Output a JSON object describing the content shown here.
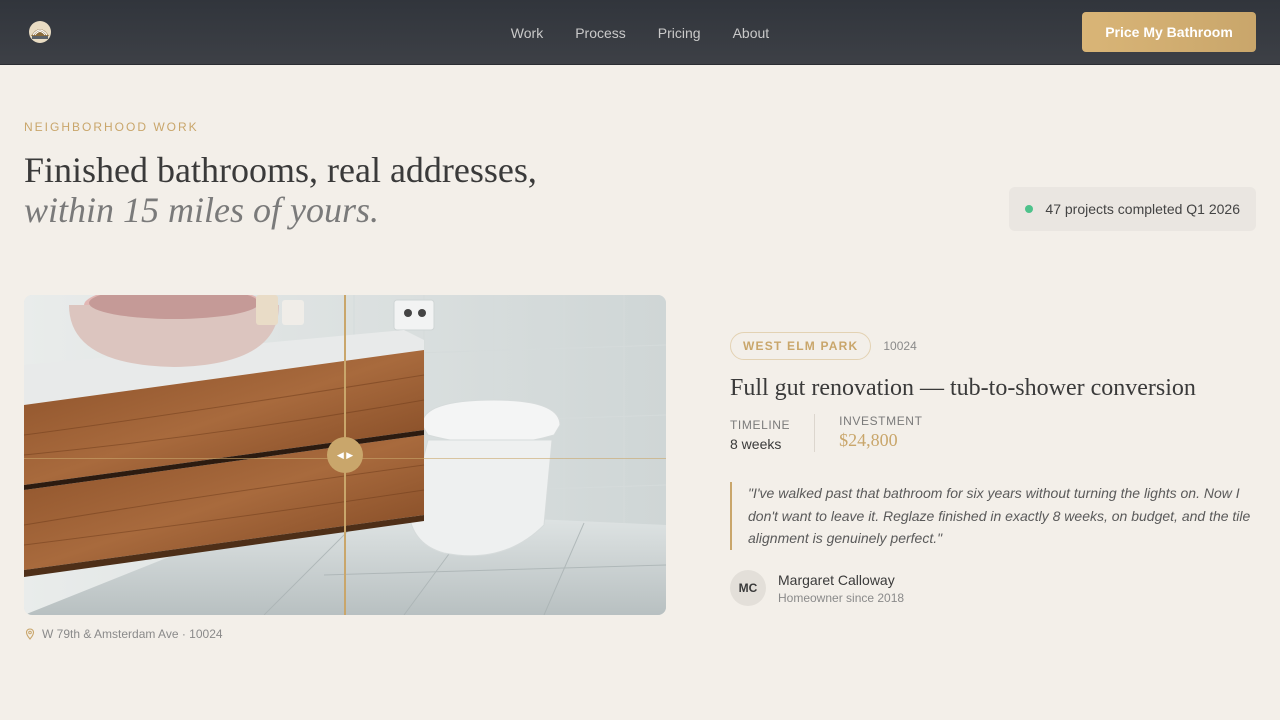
{
  "nav": {
    "links": [
      "Work",
      "Process",
      "Pricing",
      "About"
    ],
    "cta_label": "Price My Bathroom"
  },
  "hero": {
    "eyebrow": "NEIGHBORHOOD WORK",
    "headline_line1": "Finished bathrooms, real addresses,",
    "headline_line2": "within 15 miles of yours.",
    "stat": "47 projects completed Q1 2026"
  },
  "project": {
    "address": "W 79th & Amsterdam Ave · 10024",
    "neighborhood": "WEST ELM PARK",
    "zip": "10024",
    "title": "Full gut renovation — tub-to-shower conversion",
    "timeline_label": "TIMELINE",
    "timeline_value": "8 weeks",
    "investment_label": "INVESTMENT",
    "investment_value": "$24,800",
    "quote": "\"I've walked past that bathroom for six years without turning the lights on. Now I don't want to leave it. Reglaze finished in exactly 8 weeks, on budget, and the tile alignment is genuinely perfect.\"",
    "person_initials": "MC",
    "person_name": "Margaret Calloway",
    "person_sub": "Homeowner since 2018"
  },
  "colors": {
    "accent": "#c9a66b",
    "nav_bg": "#363a40",
    "page_bg": "#f3efe9",
    "status_dot": "#4ec28b"
  },
  "icons": [
    "logo-icon",
    "location-pin-icon",
    "slider-arrows-icon"
  ]
}
